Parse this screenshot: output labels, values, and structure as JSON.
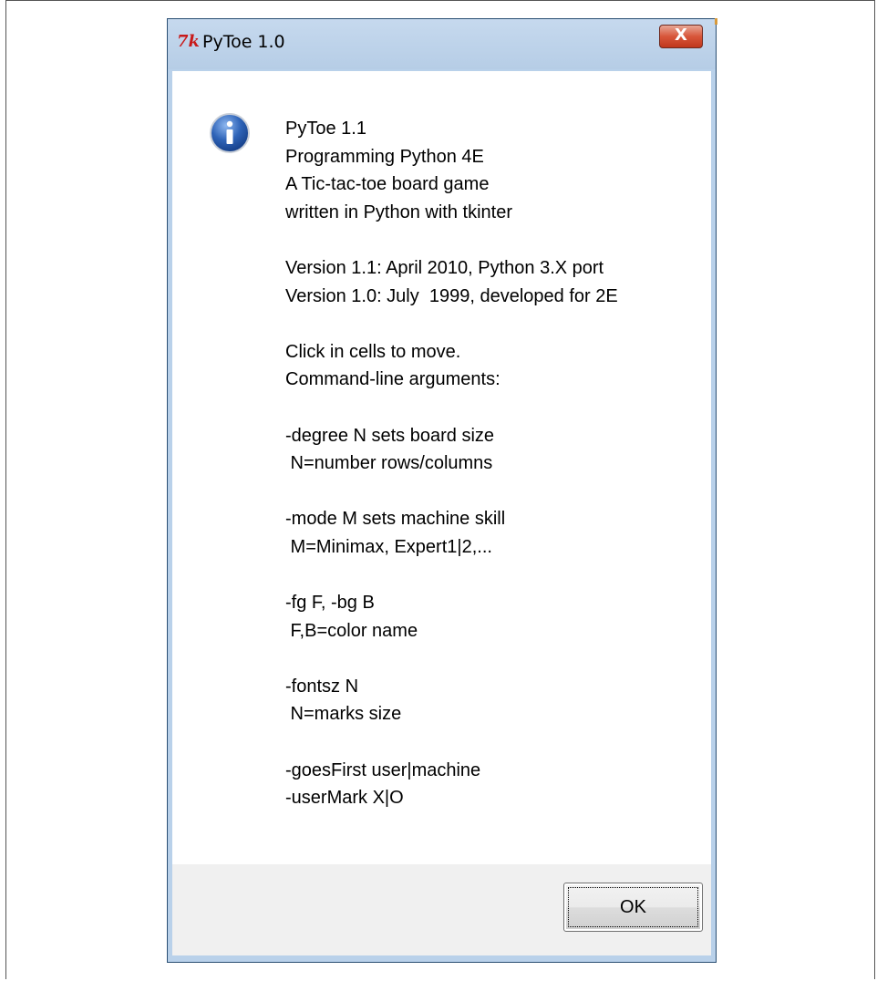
{
  "window": {
    "title": "PyToe 1.0",
    "icon": "tk-feather-icon",
    "close_label": "X"
  },
  "message": {
    "icon": "info-icon",
    "lines": [
      "PyToe 1.1",
      "Programming Python 4E",
      "A Tic-tac-toe board game",
      "written in Python with tkinter",
      "",
      "Version 1.1: April 2010, Python 3.X port",
      "Version 1.0: July  1999, developed for 2E",
      "",
      "Click in cells to move.",
      "Command-line arguments:",
      "",
      "-degree N sets board size",
      " N=number rows/columns",
      "",
      "-mode M sets machine skill",
      " M=Minimax, Expert1|2,...",
      "",
      "-fg F, -bg B",
      " F,B=color name",
      "",
      "-fontsz N",
      " N=marks size",
      "",
      "-goesFirst user|machine",
      "-userMark X|O"
    ]
  },
  "buttons": {
    "ok_label": "OK"
  },
  "colors": {
    "titlebar": "#b9d1ea",
    "close_button": "#c9462c",
    "footer": "#f0f0f0",
    "info_icon": "#2f64b8"
  }
}
